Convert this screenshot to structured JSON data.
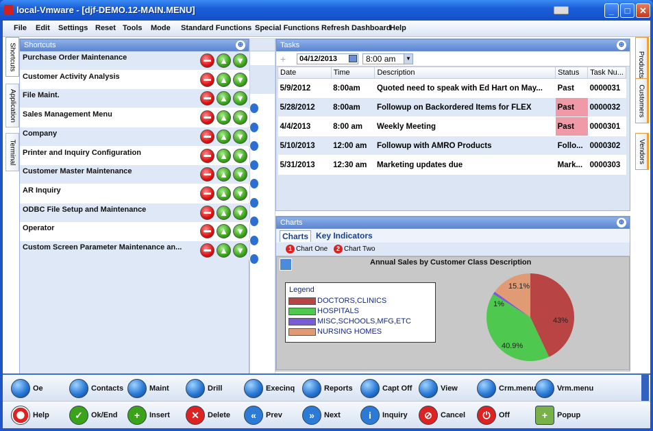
{
  "window": {
    "title": "local-Vmware - [djf-DEMO.12-MAIN.MENU]"
  },
  "menu": [
    "File",
    "Edit",
    "Settings",
    "Reset",
    "Tools",
    "Mode",
    "Standard Functions",
    "Special Functions",
    "Refresh Dashboard",
    "Help"
  ],
  "left_tabs": [
    "Shortcuts",
    "Application",
    "Terminal"
  ],
  "right_tabs": [
    "Products",
    "Customers",
    "Vendors"
  ],
  "shortcuts": {
    "title": "Shortcuts",
    "items": [
      "Purchase Order Maintenance",
      "Customer Activity Analysis",
      "File Maint.",
      "Sales Management Menu",
      "Company",
      "Printer and Inquiry Configuration",
      "Customer Master Maintenance",
      "AR Inquiry",
      "ODBC File Setup and Maintenance",
      "Operator",
      "Custom Screen Parameter Maintenance an..."
    ]
  },
  "tasks": {
    "title": "Tasks",
    "date": "04/12/2013",
    "time": "8:00 am",
    "columns": [
      "Date",
      "Time",
      "Description",
      "Status",
      "Task Nu..."
    ],
    "rows": [
      [
        "5/9/2012",
        "8:00am",
        "Quoted need to speak with Ed Hart on May...",
        "Past",
        "0000031"
      ],
      [
        "5/28/2012",
        "8:00am",
        "Followup on Backordered Items for FLEX",
        "Past",
        "0000032"
      ],
      [
        "4/4/2013",
        "8:00 am",
        "Weekly  Meeting",
        "Past",
        "0000301"
      ],
      [
        "5/10/2013",
        "12:00 am",
        "Followup with AMRO Products",
        "Follo...",
        "0000302"
      ],
      [
        "5/31/2013",
        "12:30 am",
        "Marketing updates due",
        "Mark...",
        "0000303"
      ]
    ]
  },
  "charts": {
    "title": "Charts",
    "tabs": [
      "Charts",
      "Key Indicators"
    ],
    "chart_one": "Chart One",
    "chart_two": "Chart Two",
    "badge1": "1",
    "badge2": "2"
  },
  "chart_data": {
    "type": "pie",
    "title": "Annual Sales by Customer Class Description",
    "legend_title": "Legend",
    "categories": [
      "DOCTORS,CLINICS",
      "HOSPITALS",
      "MISC,SCHOOLS,MFG,ETC",
      "NURSING HOMES"
    ],
    "values": [
      43,
      40.9,
      1,
      15.1
    ],
    "labels": [
      "43%",
      "40.9%",
      "1%",
      "15.1%"
    ],
    "colors": [
      "#b84444",
      "#4fc84f",
      "#7a5bd6",
      "#e09a74"
    ],
    "legend_position": "left"
  },
  "toolbar1": [
    "Oe",
    "Contacts",
    "Maint",
    "Drill",
    "Execinq",
    "Reports",
    "Capt Off",
    "View",
    "Crm.menu",
    "Vrm.menu"
  ],
  "toolbar2": [
    "Help",
    "Ok/End",
    "Insert",
    "Delete",
    "Prev",
    "Next",
    "Inquiry",
    "Cancel",
    "Off",
    "Popup"
  ]
}
